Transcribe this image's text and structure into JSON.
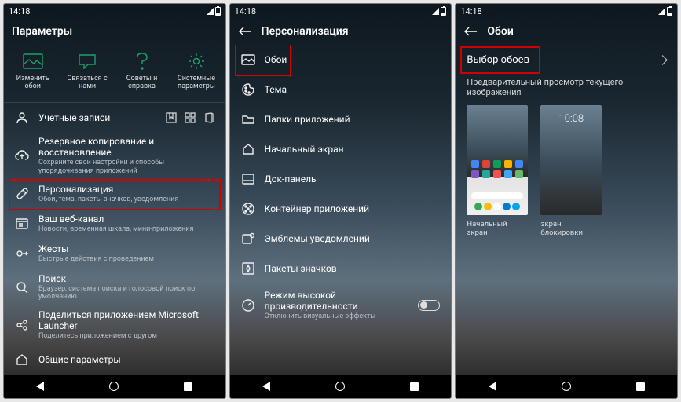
{
  "status": {
    "time": "14:18"
  },
  "screen1": {
    "title": "Параметры",
    "quick": [
      {
        "label": "Изменить обои"
      },
      {
        "label": "Связаться с нами"
      },
      {
        "label": "Советы и справка"
      },
      {
        "label": "Системные параметры"
      }
    ],
    "items": [
      {
        "title": "Учетные записи",
        "sub": ""
      },
      {
        "title": "Резервное копирование и восстановление",
        "sub": "Сохраните свои настройки и способы упорядочивания приложений"
      },
      {
        "title": "Персонализация",
        "sub": "Обои, тема, пакеты значков, уведомления"
      },
      {
        "title": "Ваш веб-канал",
        "sub": "Новости, временная шкала, мини-приложения"
      },
      {
        "title": "Жесты",
        "sub": "Быстрые действия с проведением"
      },
      {
        "title": "Поиск",
        "sub": "Браузер, система поиска и голосовой поиск по умолчанию"
      },
      {
        "title": "Поделиться приложением Microsoft Launcher",
        "sub": "Поделитесь приложением с другом"
      },
      {
        "title": "Общие параметры",
        "sub": ""
      }
    ]
  },
  "screen2": {
    "title": "Персонализация",
    "items": [
      {
        "title": "Обои"
      },
      {
        "title": "Тема"
      },
      {
        "title": "Папки приложений"
      },
      {
        "title": "Начальный экран"
      },
      {
        "title": "Док-панель"
      },
      {
        "title": "Контейнер приложений"
      },
      {
        "title": "Эмблемы уведомлений"
      },
      {
        "title": "Пакеты значков"
      },
      {
        "title": "Режим высокой производительности",
        "sub": "Отключить визуальные эффекты"
      }
    ]
  },
  "screen3": {
    "title": "Обои",
    "select_label": "Выбор обоев",
    "preview_header": "Предварительный просмотр текущего изображения",
    "lock_time": "10:08",
    "previews": [
      {
        "label": "Начальный экран"
      },
      {
        "label": "экран блокировки"
      }
    ]
  }
}
